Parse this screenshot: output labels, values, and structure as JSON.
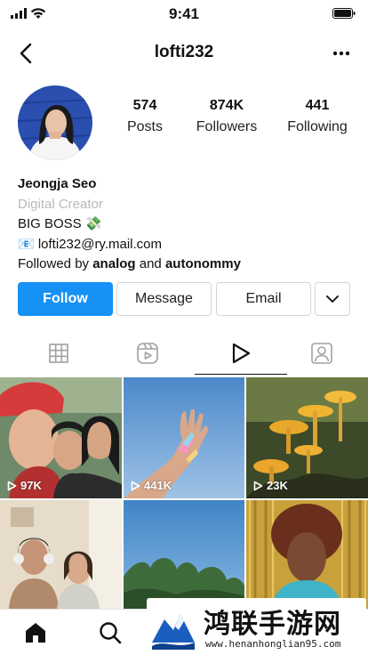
{
  "status": {
    "time": "9:41"
  },
  "header": {
    "username": "lofti232"
  },
  "profile": {
    "stats": [
      {
        "value": "574",
        "label": "Posts"
      },
      {
        "value": "874K",
        "label": "Followers"
      },
      {
        "value": "441",
        "label": "Following"
      }
    ],
    "name": "Jeongja Seo",
    "category": "Digital Creator",
    "bio_line": "BIG BOSS 💸",
    "email_line": "📧 lofti232@ry.mail.com",
    "followed_by_prefix": "Followed by ",
    "followed_by_user1": "analog",
    "followed_by_joiner": " and ",
    "followed_by_user2": "autonommy"
  },
  "actions": {
    "follow": "Follow",
    "message": "Message",
    "email": "Email"
  },
  "tabs": [
    "grid-icon",
    "reels-icon",
    "play-icon",
    "tagged-icon"
  ],
  "grid": [
    {
      "views": "97K"
    },
    {
      "views": "441K"
    },
    {
      "views": "23K"
    }
  ],
  "bottom_nav": [
    "home-icon",
    "search-icon"
  ],
  "watermark": {
    "title": "鸿联手游网",
    "url": "www.henanhonglian95.com"
  },
  "colors": {
    "follow_button": "#1691f5",
    "category_text": "#b9b9b9"
  }
}
